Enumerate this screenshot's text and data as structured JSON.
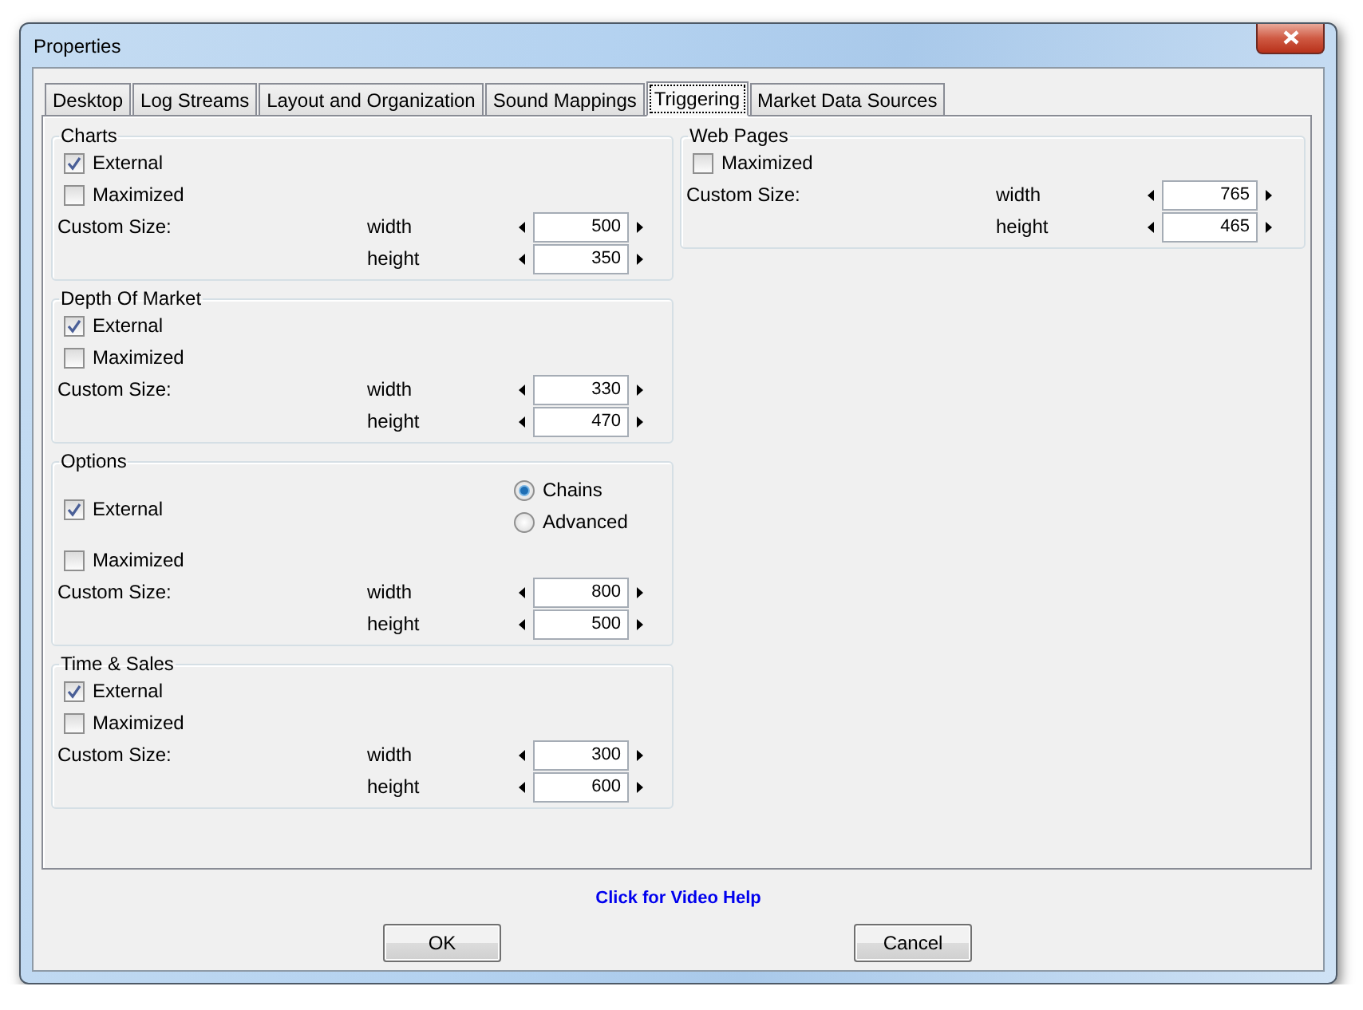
{
  "window": {
    "title": "Properties"
  },
  "tabs": [
    {
      "label": "Desktop",
      "selected": false
    },
    {
      "label": "Log Streams",
      "selected": false
    },
    {
      "label": "Layout and Organization",
      "selected": false
    },
    {
      "label": "Sound Mappings",
      "selected": false
    },
    {
      "label": "Triggering",
      "selected": true
    },
    {
      "label": "Market Data Sources",
      "selected": false
    }
  ],
  "columns": [
    {
      "groups": [
        {
          "title": "Charts",
          "options": [
            {
              "label": "External",
              "checked": true
            },
            {
              "label": "Maximized",
              "checked": false
            }
          ],
          "custom_size": {
            "label": "Custom Size:",
            "fields": [
              {
                "label": "width",
                "value": "500"
              },
              {
                "label": "height",
                "value": "350"
              }
            ]
          }
        },
        {
          "title": "Depth Of Market",
          "options": [
            {
              "label": "External",
              "checked": true
            },
            {
              "label": "Maximized",
              "checked": false
            }
          ],
          "custom_size": {
            "label": "Custom Size:",
            "fields": [
              {
                "label": "width",
                "value": "330"
              },
              {
                "label": "height",
                "value": "470"
              }
            ]
          }
        },
        {
          "title": "Options",
          "options": [
            {
              "label": "External",
              "checked": true
            },
            {
              "label": "Maximized",
              "checked": false
            }
          ],
          "radios": [
            {
              "label": "Chains",
              "selected": true
            },
            {
              "label": "Advanced",
              "selected": false
            }
          ],
          "custom_size": {
            "label": "Custom Size:",
            "fields": [
              {
                "label": "width",
                "value": "800"
              },
              {
                "label": "height",
                "value": "500"
              }
            ]
          }
        },
        {
          "title": "Time & Sales",
          "options": [
            {
              "label": "External",
              "checked": true
            },
            {
              "label": "Maximized",
              "checked": false
            }
          ],
          "custom_size": {
            "label": "Custom Size:",
            "fields": [
              {
                "label": "width",
                "value": "300"
              },
              {
                "label": "height",
                "value": "600"
              }
            ]
          }
        }
      ]
    },
    {
      "groups": [
        {
          "title": "Web Pages",
          "options": [
            {
              "label": "Maximized",
              "checked": false
            }
          ],
          "custom_size": {
            "label": "Custom Size:",
            "fields": [
              {
                "label": "width",
                "value": "765"
              },
              {
                "label": "height",
                "value": "465"
              }
            ]
          }
        }
      ]
    }
  ],
  "help_link": "Click for Video Help",
  "buttons": [
    {
      "label": "OK"
    },
    {
      "label": "Cancel"
    }
  ]
}
